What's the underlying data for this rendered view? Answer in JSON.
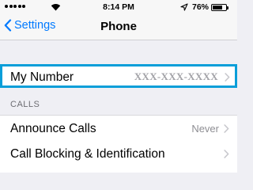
{
  "status_bar": {
    "time": "8:14 PM",
    "battery_text": "76%",
    "battery_level": 0.76
  },
  "nav": {
    "back_label": "Settings",
    "title": "Phone"
  },
  "my_number": {
    "label": "My Number",
    "value": "XXX-XXX-XXXX"
  },
  "calls_section": {
    "header": "CALLS",
    "items": [
      {
        "label": "Announce Calls",
        "value": "Never"
      },
      {
        "label": "Call Blocking & Identification",
        "value": ""
      }
    ]
  },
  "colors": {
    "accent": "#007aff",
    "highlight_border": "#0a9ed9",
    "background": "#efeff4"
  }
}
